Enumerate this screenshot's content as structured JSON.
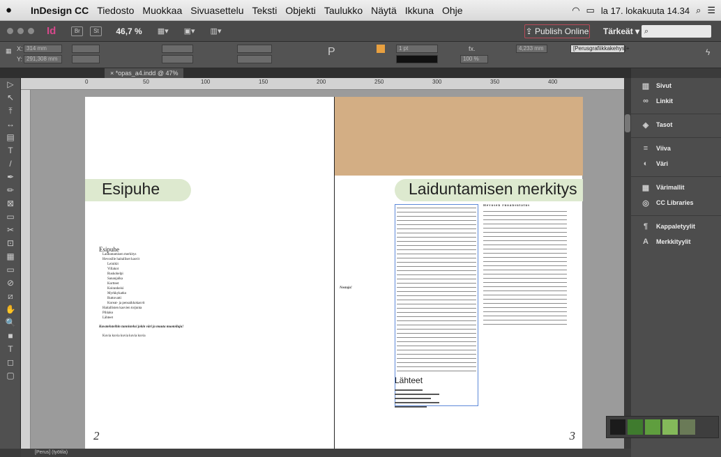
{
  "menubar": {
    "app": "InDesign CC",
    "items": [
      "Tiedosto",
      "Muokkaa",
      "Sivuasettelu",
      "Teksti",
      "Objekti",
      "Taulukko",
      "Näytä",
      "Ikkuna",
      "Ohje"
    ],
    "clock": "la 17. lokakuuta 14.34"
  },
  "appbar": {
    "logo": "Id",
    "br": "Br",
    "st": "St",
    "zoom": "46,7 %",
    "publish": "Publish Online",
    "workspace": "Tärkeät",
    "search_placeholder": ""
  },
  "control": {
    "x": "314 mm",
    "y": "291,308 mm",
    "stroke": "1 pt",
    "scale": "100 %",
    "width_val": "4,233 mm",
    "style": "[Perusgrafiikkakehys]+"
  },
  "tab": {
    "title": "*opas_a4.indd @ 47%"
  },
  "ruler": [
    "0",
    "50",
    "100",
    "150",
    "200",
    "250",
    "300",
    "350",
    "400"
  ],
  "tools": [
    "▷",
    "↖",
    "⤒",
    "↔",
    "▤",
    "T",
    "/",
    "✒",
    "✏",
    "⊠",
    "▭",
    "✂",
    "⊡",
    "▦",
    "▭",
    "⊘",
    "⧄",
    "✋",
    "🔍",
    "■",
    "T",
    "◻",
    "▢"
  ],
  "left_page": {
    "heading": "Esipuhe",
    "toc_title": "Esipuhe",
    "toc": [
      {
        "t": "Laiduntamisen merkitys",
        "lvl": 1
      },
      {
        "t": "Hevosille haitalliset kasvit",
        "lvl": 1
      },
      {
        "t": "Leinikit",
        "lvl": 2
      },
      {
        "t": "Villakot",
        "lvl": 2
      },
      {
        "t": "Ruskohelpi",
        "lvl": 2
      },
      {
        "t": "Sananjalka",
        "lvl": 2
      },
      {
        "t": "Kortteet",
        "lvl": 2
      },
      {
        "t": "Koiranheisi",
        "lvl": 2
      },
      {
        "t": "Myrkkykatko",
        "lvl": 2
      },
      {
        "t": "Ruttovatti",
        "lvl": 2
      },
      {
        "t": "Koreat- ja pensaikkokasvit",
        "lvl": 2
      },
      {
        "t": "Haitallisten kasvien torjunta",
        "lvl": 1
      },
      {
        "t": "Pihlako",
        "lvl": 1
      },
      {
        "t": "Lähteet",
        "lvl": 1
      }
    ],
    "toc_italic": "Kuvateksteihin tunnisteksi jokin väri ja muuta muotoiluja!",
    "toc_last": "Kuvia kuvia kuvia kuvia kuvia",
    "page_number": "2",
    "aside": "Nostoja!"
  },
  "right_page": {
    "heading": "Laiduntamisen merkitys",
    "sources": "Lähteet",
    "col2_title": "Hevosen ruoansulatus",
    "page_number": "3"
  },
  "panels": [
    {
      "icon": "pages-icon",
      "glyph": "▥",
      "label": "Sivut"
    },
    {
      "icon": "links-icon",
      "glyph": "∞",
      "label": "Linkit"
    },
    {
      "icon": "layers-icon",
      "glyph": "◈",
      "label": "Tasot"
    },
    {
      "icon": "stroke-icon",
      "glyph": "≡",
      "label": "Viiva"
    },
    {
      "icon": "color-icon",
      "glyph": "◐",
      "label": "Väri"
    },
    {
      "icon": "swatches-icon",
      "glyph": "▦",
      "label": "Värimallit"
    },
    {
      "icon": "cc-libraries-icon",
      "glyph": "◎",
      "label": "CC Libraries"
    },
    {
      "icon": "paragraph-styles-icon",
      "glyph": "¶",
      "label": "Kappaletyylit"
    },
    {
      "icon": "character-styles-icon",
      "glyph": "A",
      "label": "Merkkityylit"
    }
  ],
  "swatch_colors": [
    "#1b1b1b",
    "#3f7b2e",
    "#5f9e3e",
    "#84b95a",
    "#6a7a57"
  ],
  "status": {
    "page_field": "[Perus] (työtila)"
  }
}
